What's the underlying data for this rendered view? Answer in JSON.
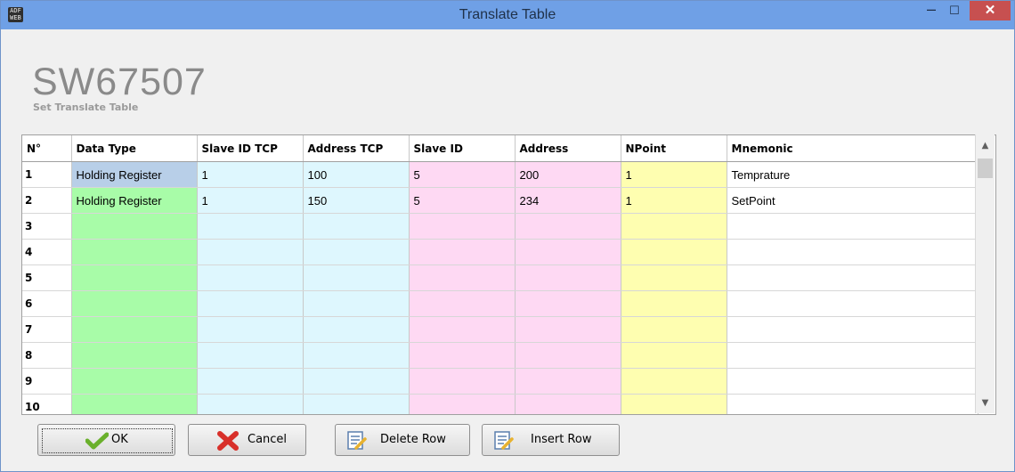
{
  "window": {
    "title": "Translate Table",
    "icon_text": "ADF WEB",
    "controls": {
      "minimize": "–",
      "maximize": "☐",
      "close": "✕"
    }
  },
  "header": {
    "title": "SW67507",
    "subtitle": "Set Translate Table"
  },
  "table": {
    "columns": [
      "N°",
      "Data Type",
      "Slave ID TCP",
      "Address TCP",
      "Slave ID",
      "Address",
      "NPoint",
      "Mnemonic"
    ],
    "column_colors": [
      "#ffffff",
      "#a8fca8",
      "#def7fe",
      "#def7fe",
      "#fed9f3",
      "#fed9f3",
      "#fefeb0",
      "#ffffff"
    ],
    "selected_cell_color": "#b8cfe8",
    "rows": [
      [
        "1",
        "Holding Register",
        "1",
        "100",
        "5",
        "200",
        "1",
        "Temprature"
      ],
      [
        "2",
        "Holding Register",
        "1",
        "150",
        "5",
        "234",
        "1",
        "SetPoint"
      ],
      [
        "3",
        "",
        "",
        "",
        "",
        "",
        "",
        ""
      ],
      [
        "4",
        "",
        "",
        "",
        "",
        "",
        "",
        ""
      ],
      [
        "5",
        "",
        "",
        "",
        "",
        "",
        "",
        ""
      ],
      [
        "6",
        "",
        "",
        "",
        "",
        "",
        "",
        ""
      ],
      [
        "7",
        "",
        "",
        "",
        "",
        "",
        "",
        ""
      ],
      [
        "8",
        "",
        "",
        "",
        "",
        "",
        "",
        ""
      ],
      [
        "9",
        "",
        "",
        "",
        "",
        "",
        "",
        ""
      ],
      [
        "10",
        "",
        "",
        "",
        "",
        "",
        "",
        ""
      ]
    ]
  },
  "buttons": {
    "ok": "OK",
    "cancel": "Cancel",
    "delete_row": "Delete Row",
    "insert_row": "Insert Row"
  }
}
